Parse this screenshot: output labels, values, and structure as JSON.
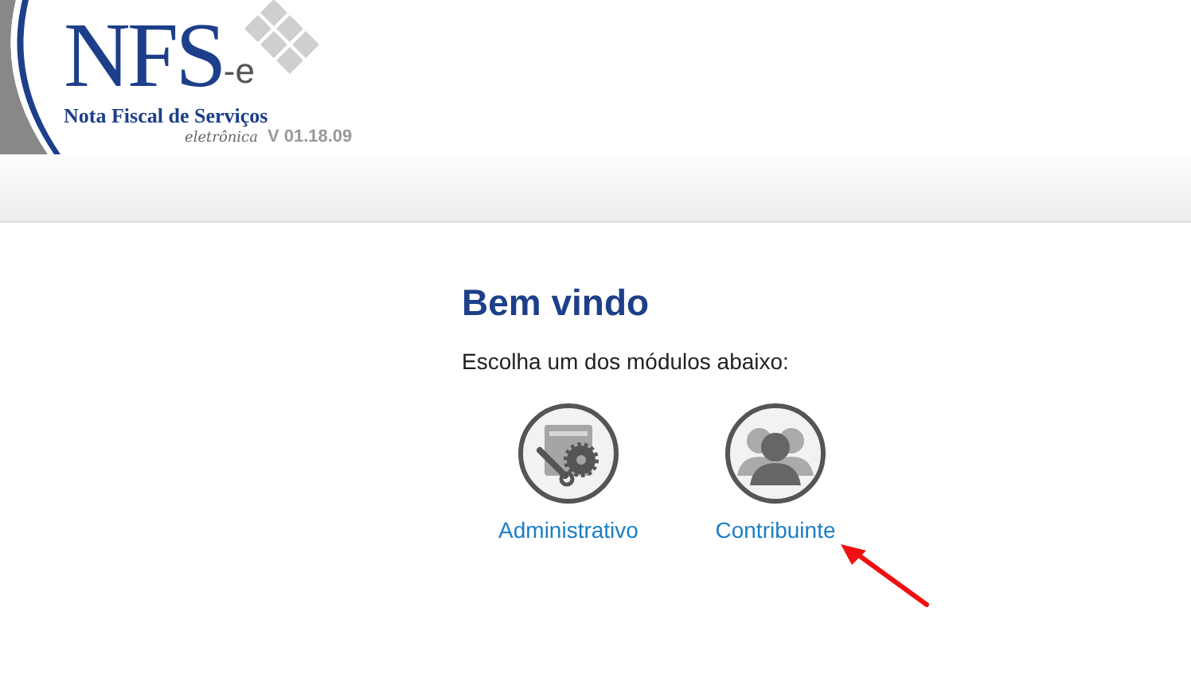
{
  "logo": {
    "main": "NFS",
    "suffix": "-e",
    "subtitle": "Nota Fiscal de Serviços",
    "tagline": "eletrônica"
  },
  "version": "V 01.18.09",
  "title": "Bem vindo",
  "subtitle": "Escolha um dos módulos abaixo:",
  "modules": [
    {
      "label": "Administrativo",
      "kind": "admin"
    },
    {
      "label": "Contribuinte",
      "kind": "taxpayer"
    }
  ]
}
